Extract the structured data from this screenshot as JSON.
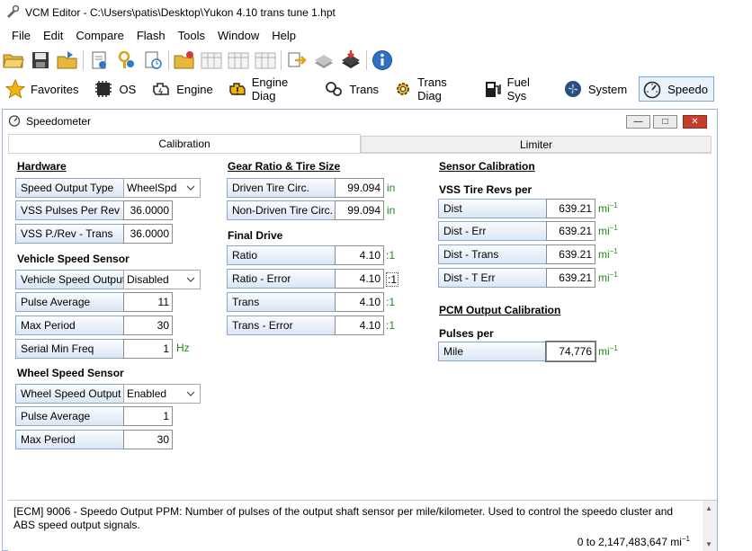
{
  "app": {
    "title": "VCM Editor - C:\\Users\\patis\\Desktop\\Yukon 4.10 trans tune 1.hpt"
  },
  "menu": [
    "File",
    "Edit",
    "Compare",
    "Flash",
    "Tools",
    "Window",
    "Help"
  ],
  "toolbar_icons": [
    "open-folder-icon",
    "save-icon",
    "export-icon",
    "info-page-icon",
    "key-user-icon",
    "history-icon",
    "open-tune-icon",
    "table-icon",
    "table-icon",
    "table-icon",
    "swap-icon",
    "chip-icon",
    "chip-write-icon",
    "info-icon"
  ],
  "modules": [
    {
      "label": "Favorites",
      "icon": "star-icon"
    },
    {
      "label": "OS",
      "icon": "chip-icon"
    },
    {
      "label": "Engine",
      "icon": "engine-icon"
    },
    {
      "label": "Engine Diag",
      "icon": "engine-diag-icon"
    },
    {
      "label": "Trans",
      "icon": "transmission-icon"
    },
    {
      "label": "Trans Diag",
      "icon": "gear-icon"
    },
    {
      "label": "Fuel Sys",
      "icon": "fuel-pump-icon"
    },
    {
      "label": "System",
      "icon": "fan-icon"
    },
    {
      "label": "Speedo",
      "icon": "speedometer-icon",
      "active": true
    }
  ],
  "window": {
    "title": "Speedometer",
    "controls": {
      "minimize": "—",
      "restore": "□",
      "close": "✕"
    }
  },
  "tabs": [
    "Calibration",
    "Limiter"
  ],
  "hardware": {
    "heading": "Hardware",
    "speed_output_type": {
      "label": "Speed Output Type",
      "value": "WheelSpd"
    },
    "vss_pulses_per_rev": {
      "label": "VSS Pulses Per Rev",
      "value": "36.0000"
    },
    "vss_p_rev_trans": {
      "label": "VSS P./Rev - Trans",
      "value": "36.0000"
    }
  },
  "vehicle_speed_sensor": {
    "heading": "Vehicle Speed Sensor",
    "output": {
      "label": "Vehicle Speed Output",
      "value": "Disabled"
    },
    "pulse_average": {
      "label": "Pulse Average",
      "value": "11"
    },
    "max_period": {
      "label": "Max Period",
      "value": "30"
    },
    "serial_min_freq": {
      "label": "Serial Min Freq",
      "value": "1",
      "unit": "Hz"
    }
  },
  "wheel_speed_sensor": {
    "heading": "Wheel Speed Sensor",
    "output": {
      "label": "Wheel Speed Output",
      "value": "Enabled"
    },
    "pulse_average": {
      "label": "Pulse Average",
      "value": "1"
    },
    "max_period": {
      "label": "Max Period",
      "value": "30"
    }
  },
  "gear_ratio": {
    "heading": "Gear Ratio & Tire Size",
    "driven_tire": {
      "label": "Driven Tire Circ.",
      "value": "99.094",
      "unit": "in"
    },
    "non_driven_tire": {
      "label": "Non-Driven Tire Circ.",
      "value": "99.094",
      "unit": "in"
    }
  },
  "final_drive": {
    "heading": "Final Drive",
    "ratio": {
      "label": "Ratio",
      "value": "4.10",
      "unit": ":1"
    },
    "ratio_error": {
      "label": "Ratio - Error",
      "value": "4.10",
      "unit": ":1"
    },
    "trans": {
      "label": "Trans",
      "value": "4.10",
      "unit": ":1"
    },
    "trans_error": {
      "label": "Trans - Error",
      "value": "4.10",
      "unit": ":1"
    }
  },
  "sensor_calibration": {
    "heading": "Sensor Calibration",
    "vss_heading": "VSS Tire Revs per",
    "dist": {
      "label": "Dist",
      "value": "639.21",
      "unit": "mi",
      "unit_sup": "−1"
    },
    "dist_err": {
      "label": "Dist - Err",
      "value": "639.21",
      "unit": "mi",
      "unit_sup": "−1"
    },
    "dist_trans": {
      "label": "Dist - Trans",
      "value": "639.21",
      "unit": "mi",
      "unit_sup": "−1"
    },
    "dist_t_err": {
      "label": "Dist - T Err",
      "value": "639.21",
      "unit": "mi",
      "unit_sup": "−1"
    }
  },
  "pcm_output": {
    "heading": "PCM Output Calibration",
    "pulses_heading": "Pulses per",
    "mile": {
      "label": "Mile",
      "value": "74,776",
      "unit": "mi",
      "unit_sup": "−1"
    }
  },
  "status": {
    "description": "[ECM] 9006 - Speedo Output PPM: Number of pulses of the output shaft sensor per mile/kilometer. Used to control the speedo cluster and ABS speed output signals.",
    "range": "0 to 2,147,483,647 mi",
    "range_sup": "−1"
  }
}
